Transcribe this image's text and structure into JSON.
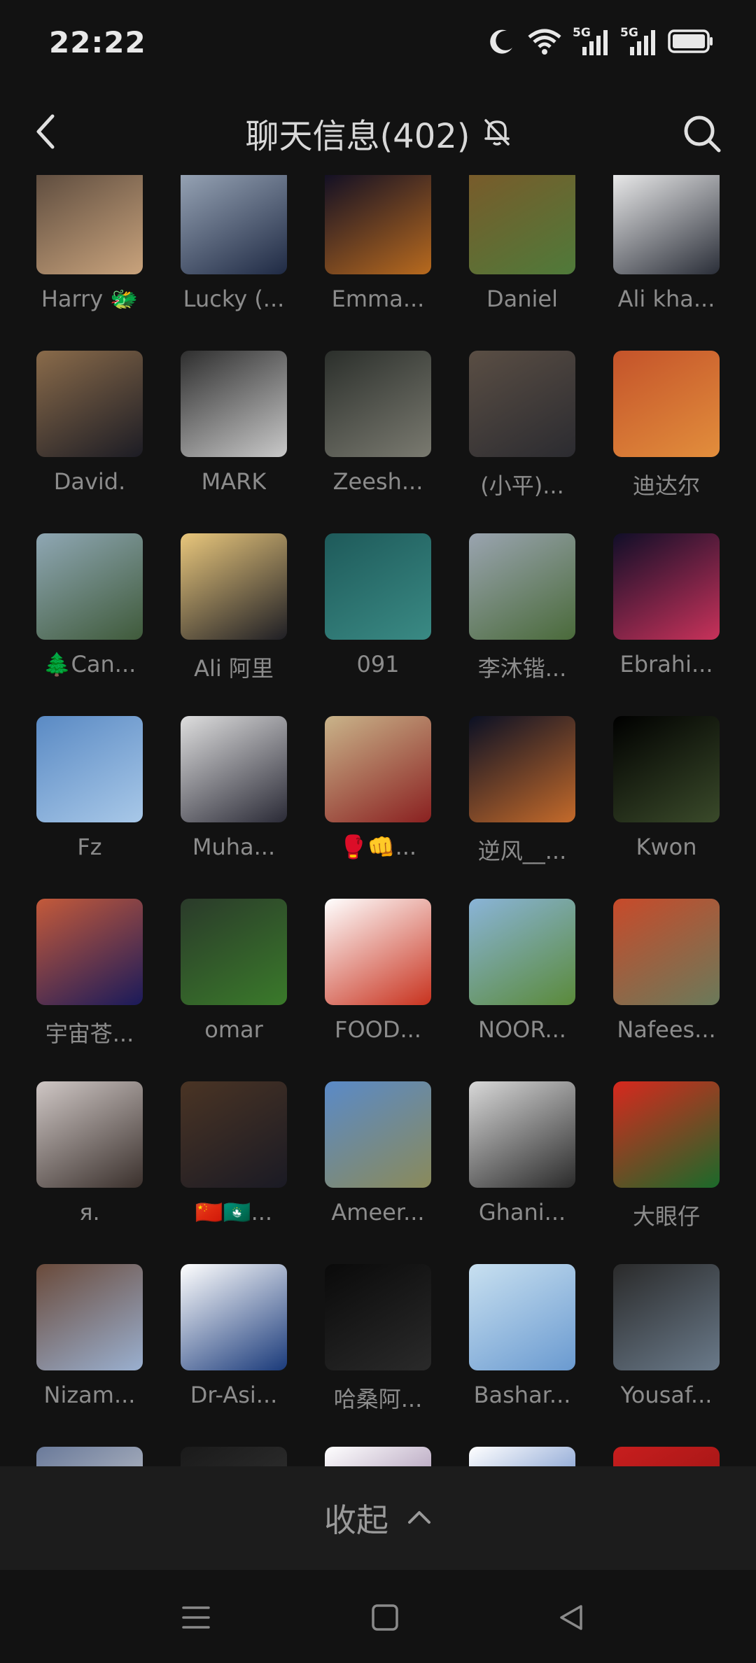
{
  "status_bar": {
    "time": "22:22",
    "icons": [
      "moon-icon",
      "wifi-icon",
      "5g-signal-icon",
      "5g-signal-icon",
      "battery-icon"
    ],
    "network_label_1": "5G",
    "network_label_2": "5G"
  },
  "header": {
    "title": "聊天信息(402)",
    "back_icon": "chevron-left-icon",
    "mute_icon": "bell-off-icon",
    "search_icon": "search-icon"
  },
  "members": [
    {
      "name": "Harry 🐲",
      "colors": [
        "#5b4a3d",
        "#c9a37c"
      ]
    },
    {
      "name": "Lucky (...",
      "colors": [
        "#9aa7b8",
        "#1f2a44"
      ]
    },
    {
      "name": "Emma...",
      "colors": [
        "#0c0c24",
        "#b86a1e"
      ]
    },
    {
      "name": "Daniel",
      "colors": [
        "#7a5a2a",
        "#4f7a3a"
      ]
    },
    {
      "name": "Ali kha...",
      "colors": [
        "#f0f0f0",
        "#2a2e38"
      ]
    },
    {
      "name": "David.",
      "colors": [
        "#8a6b4a",
        "#1c1c24"
      ]
    },
    {
      "name": "MARK",
      "colors": [
        "#2e2e2e",
        "#c9c9c9"
      ]
    },
    {
      "name": "Zeesh...",
      "colors": [
        "#2b2f2b",
        "#7a7a70"
      ]
    },
    {
      "name": "(小平)...",
      "colors": [
        "#5a4e44",
        "#2b2b30"
      ]
    },
    {
      "name": "迪达尔",
      "colors": [
        "#c4532a",
        "#e28e3c"
      ]
    },
    {
      "name": "🌲Can...",
      "colors": [
        "#8fa7b4",
        "#3f5a3a"
      ]
    },
    {
      "name": "Ali 阿里",
      "colors": [
        "#e9c77c",
        "#1e1e24"
      ]
    },
    {
      "name": "091",
      "colors": [
        "#1e5a5a",
        "#3a8a84"
      ]
    },
    {
      "name": "李沐锴...",
      "colors": [
        "#9aa4b0",
        "#4a6a3a"
      ]
    },
    {
      "name": "Ebrahi...",
      "colors": [
        "#100e28",
        "#c8325a"
      ]
    },
    {
      "name": "Fz",
      "colors": [
        "#5a8ac4",
        "#a8c8e8"
      ]
    },
    {
      "name": "Muha...",
      "colors": [
        "#dedede",
        "#2a2a36"
      ]
    },
    {
      "name": "🥊👊...",
      "colors": [
        "#c9b48a",
        "#8a2020"
      ]
    },
    {
      "name": "逆风__...",
      "colors": [
        "#0a1024",
        "#c46a2a"
      ]
    },
    {
      "name": "Kwon",
      "colors": [
        "#000000",
        "#3a4a2a"
      ]
    },
    {
      "name": "宇宙苍...",
      "colors": [
        "#c45a3a",
        "#1a1a5a"
      ]
    },
    {
      "name": "omar",
      "colors": [
        "#2a3a2a",
        "#3a7a2a"
      ]
    },
    {
      "name": "FOOD...",
      "colors": [
        "#ffffff",
        "#c8321e"
      ]
    },
    {
      "name": "NOOR...",
      "colors": [
        "#8ab4d8",
        "#5a8a3a"
      ]
    },
    {
      "name": "Nafees...",
      "colors": [
        "#c84a2a",
        "#6a7a5a"
      ]
    },
    {
      "name": "я.",
      "colors": [
        "#cfc7c5",
        "#3a302c"
      ]
    },
    {
      "name": "🇨🇳🇲🇴...",
      "colors": [
        "#4a3424",
        "#1a1a24"
      ]
    },
    {
      "name": "Ameer...",
      "colors": [
        "#5a8ac8",
        "#8a8a5a"
      ]
    },
    {
      "name": "Ghani...",
      "colors": [
        "#d8d8d8",
        "#2a2a2a"
      ]
    },
    {
      "name": "大眼仔",
      "colors": [
        "#d8281e",
        "#1a6a2a"
      ]
    },
    {
      "name": "Nizam...",
      "colors": [
        "#6a4a3a",
        "#9ab0d0"
      ]
    },
    {
      "name": "Dr-Asi...",
      "colors": [
        "#ffffff",
        "#1a3a7a"
      ]
    },
    {
      "name": "哈桑阿...",
      "colors": [
        "#0a0a0a",
        "#2a2a2a"
      ]
    },
    {
      "name": "Bashar...",
      "colors": [
        "#c8e0f0",
        "#6a9ad0"
      ]
    },
    {
      "name": "Yousaf...",
      "colors": [
        "#2a2a2a",
        "#6a7a8a"
      ]
    },
    {
      "name": "",
      "colors": [
        "#6a7a9a",
        "#d8d8d8"
      ]
    },
    {
      "name": "",
      "colors": [
        "#1a1a1a",
        "#3a3a3a"
      ]
    },
    {
      "name": "",
      "colors": [
        "#ffffff",
        "#7a5a8a"
      ]
    },
    {
      "name": "",
      "colors": [
        "#ffffff",
        "#2a5ab0"
      ]
    },
    {
      "name": "",
      "colors": [
        "#c81e1e",
        "#8a1010"
      ]
    }
  ],
  "collapse": {
    "label": "收起",
    "icon": "chevron-up-icon"
  },
  "system_nav": {
    "menu_icon": "menu-icon",
    "home_icon": "square-home-icon",
    "back_icon": "triangle-back-icon"
  }
}
